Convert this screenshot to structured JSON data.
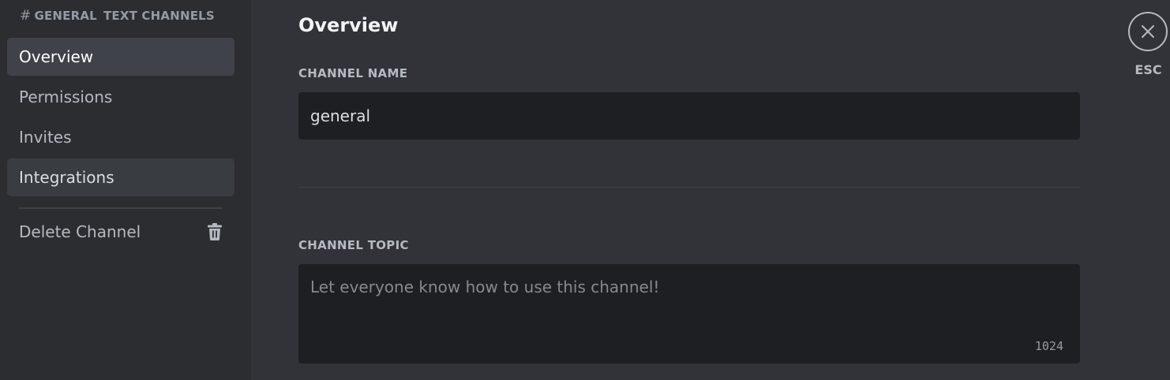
{
  "sidebar": {
    "header_channel": "GENERAL",
    "header_category": "TEXT CHANNELS",
    "hash_symbol": "#",
    "items": [
      {
        "label": "Overview",
        "state": "selected"
      },
      {
        "label": "Permissions",
        "state": "normal"
      },
      {
        "label": "Invites",
        "state": "normal"
      },
      {
        "label": "Integrations",
        "state": "hovered"
      }
    ],
    "delete_label": "Delete Channel",
    "delete_icon": "trash-icon"
  },
  "main": {
    "title": "Overview",
    "channel_name_label": "CHANNEL NAME",
    "channel_name_value": "general",
    "channel_topic_label": "CHANNEL TOPIC",
    "channel_topic_value": "",
    "channel_topic_placeholder": "Let everyone know how to use this channel!",
    "char_count": "1024"
  },
  "close": {
    "label": "ESC",
    "icon": "close-icon"
  },
  "colors": {
    "sidebar_bg": "#2b2d31",
    "main_bg": "#313338",
    "input_bg": "#1e1f22",
    "selected_bg": "#404249",
    "text_muted": "#b5bac1"
  }
}
